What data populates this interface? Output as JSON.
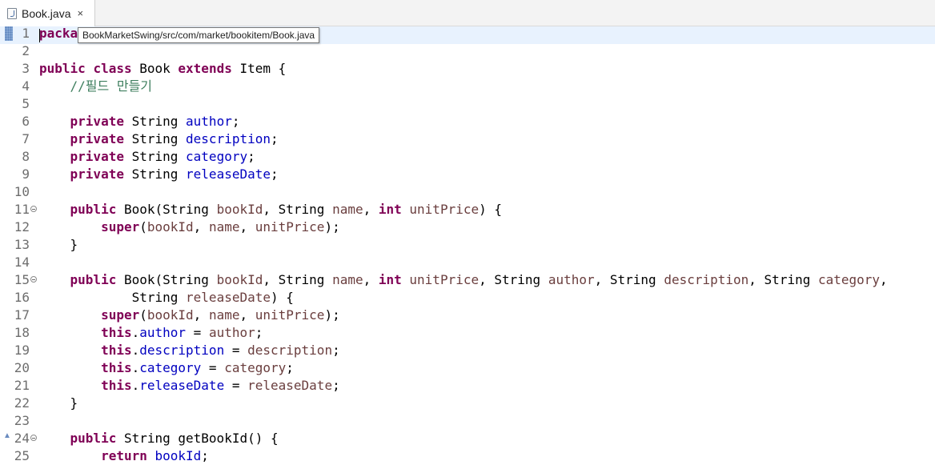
{
  "tab": {
    "label": "Book.java",
    "close": "×",
    "icon": "java-file-icon"
  },
  "tooltip": {
    "text": "BookMarketSwing/src/com/market/bookitem/Book.java"
  },
  "colors": {
    "keyword": "#7f0055",
    "field": "#0000c0",
    "parameter": "#6a3e3e",
    "comment": "#3f7f5f",
    "current_line": "#e8f2fe"
  },
  "lines": [
    {
      "n": "1",
      "tokens": [
        {
          "t": "packa",
          "c": "kw"
        }
      ]
    },
    {
      "n": "2",
      "tokens": []
    },
    {
      "n": "3",
      "tokens": [
        {
          "t": "public",
          "c": "kw"
        },
        {
          "t": " "
        },
        {
          "t": "class",
          "c": "kw"
        },
        {
          "t": " Book "
        },
        {
          "t": "extends",
          "c": "kw"
        },
        {
          "t": " Item {"
        }
      ]
    },
    {
      "n": "4",
      "tokens": [
        {
          "t": "    "
        },
        {
          "t": "//필드 만들기",
          "c": "cmt"
        }
      ]
    },
    {
      "n": "5",
      "tokens": []
    },
    {
      "n": "6",
      "tokens": [
        {
          "t": "    "
        },
        {
          "t": "private",
          "c": "kw"
        },
        {
          "t": " String "
        },
        {
          "t": "author",
          "c": "fld"
        },
        {
          "t": ";"
        }
      ]
    },
    {
      "n": "7",
      "tokens": [
        {
          "t": "    "
        },
        {
          "t": "private",
          "c": "kw"
        },
        {
          "t": " String "
        },
        {
          "t": "description",
          "c": "fld"
        },
        {
          "t": ";"
        }
      ]
    },
    {
      "n": "8",
      "tokens": [
        {
          "t": "    "
        },
        {
          "t": "private",
          "c": "kw"
        },
        {
          "t": " String "
        },
        {
          "t": "category",
          "c": "fld"
        },
        {
          "t": ";"
        }
      ]
    },
    {
      "n": "9",
      "tokens": [
        {
          "t": "    "
        },
        {
          "t": "private",
          "c": "kw"
        },
        {
          "t": " String "
        },
        {
          "t": "releaseDate",
          "c": "fld"
        },
        {
          "t": ";"
        }
      ]
    },
    {
      "n": "10",
      "tokens": []
    },
    {
      "n": "11",
      "fold": true,
      "tokens": [
        {
          "t": "    "
        },
        {
          "t": "public",
          "c": "kw"
        },
        {
          "t": " Book(String "
        },
        {
          "t": "bookId",
          "c": "par"
        },
        {
          "t": ", String "
        },
        {
          "t": "name",
          "c": "par"
        },
        {
          "t": ", "
        },
        {
          "t": "int",
          "c": "kw"
        },
        {
          "t": " "
        },
        {
          "t": "unitPrice",
          "c": "par"
        },
        {
          "t": ") {"
        }
      ]
    },
    {
      "n": "12",
      "tokens": [
        {
          "t": "        "
        },
        {
          "t": "super",
          "c": "kw"
        },
        {
          "t": "("
        },
        {
          "t": "bookId",
          "c": "par"
        },
        {
          "t": ", "
        },
        {
          "t": "name",
          "c": "par"
        },
        {
          "t": ", "
        },
        {
          "t": "unitPrice",
          "c": "par"
        },
        {
          "t": ");"
        }
      ]
    },
    {
      "n": "13",
      "tokens": [
        {
          "t": "    }"
        }
      ]
    },
    {
      "n": "14",
      "tokens": []
    },
    {
      "n": "15",
      "fold": true,
      "tokens": [
        {
          "t": "    "
        },
        {
          "t": "public",
          "c": "kw"
        },
        {
          "t": " Book(String "
        },
        {
          "t": "bookId",
          "c": "par"
        },
        {
          "t": ", String "
        },
        {
          "t": "name",
          "c": "par"
        },
        {
          "t": ", "
        },
        {
          "t": "int",
          "c": "kw"
        },
        {
          "t": " "
        },
        {
          "t": "unitPrice",
          "c": "par"
        },
        {
          "t": ", String "
        },
        {
          "t": "author",
          "c": "par"
        },
        {
          "t": ", String "
        },
        {
          "t": "description",
          "c": "par"
        },
        {
          "t": ", String "
        },
        {
          "t": "category",
          "c": "par"
        },
        {
          "t": ","
        }
      ]
    },
    {
      "n": "16",
      "tokens": [
        {
          "t": "            String "
        },
        {
          "t": "releaseDate",
          "c": "par"
        },
        {
          "t": ") {"
        }
      ]
    },
    {
      "n": "17",
      "tokens": [
        {
          "t": "        "
        },
        {
          "t": "super",
          "c": "kw"
        },
        {
          "t": "("
        },
        {
          "t": "bookId",
          "c": "par"
        },
        {
          "t": ", "
        },
        {
          "t": "name",
          "c": "par"
        },
        {
          "t": ", "
        },
        {
          "t": "unitPrice",
          "c": "par"
        },
        {
          "t": ");"
        }
      ]
    },
    {
      "n": "18",
      "tokens": [
        {
          "t": "        "
        },
        {
          "t": "this",
          "c": "kw"
        },
        {
          "t": "."
        },
        {
          "t": "author",
          "c": "fld"
        },
        {
          "t": " = "
        },
        {
          "t": "author",
          "c": "par"
        },
        {
          "t": ";"
        }
      ]
    },
    {
      "n": "19",
      "tokens": [
        {
          "t": "        "
        },
        {
          "t": "this",
          "c": "kw"
        },
        {
          "t": "."
        },
        {
          "t": "description",
          "c": "fld"
        },
        {
          "t": " = "
        },
        {
          "t": "description",
          "c": "par"
        },
        {
          "t": ";"
        }
      ]
    },
    {
      "n": "20",
      "tokens": [
        {
          "t": "        "
        },
        {
          "t": "this",
          "c": "kw"
        },
        {
          "t": "."
        },
        {
          "t": "category",
          "c": "fld"
        },
        {
          "t": " = "
        },
        {
          "t": "category",
          "c": "par"
        },
        {
          "t": ";"
        }
      ]
    },
    {
      "n": "21",
      "tokens": [
        {
          "t": "        "
        },
        {
          "t": "this",
          "c": "kw"
        },
        {
          "t": "."
        },
        {
          "t": "releaseDate",
          "c": "fld"
        },
        {
          "t": " = "
        },
        {
          "t": "releaseDate",
          "c": "par"
        },
        {
          "t": ";"
        }
      ]
    },
    {
      "n": "22",
      "tokens": [
        {
          "t": "    }"
        }
      ]
    },
    {
      "n": "23",
      "tokens": []
    },
    {
      "n": "24",
      "fold": true,
      "override": true,
      "tokens": [
        {
          "t": "    "
        },
        {
          "t": "public",
          "c": "kw"
        },
        {
          "t": " String getBookId() {"
        }
      ]
    },
    {
      "n": "25",
      "tokens": [
        {
          "t": "        "
        },
        {
          "t": "return",
          "c": "kw"
        },
        {
          "t": " "
        },
        {
          "t": "bookId",
          "c": "fld"
        },
        {
          "t": ";"
        }
      ]
    }
  ]
}
